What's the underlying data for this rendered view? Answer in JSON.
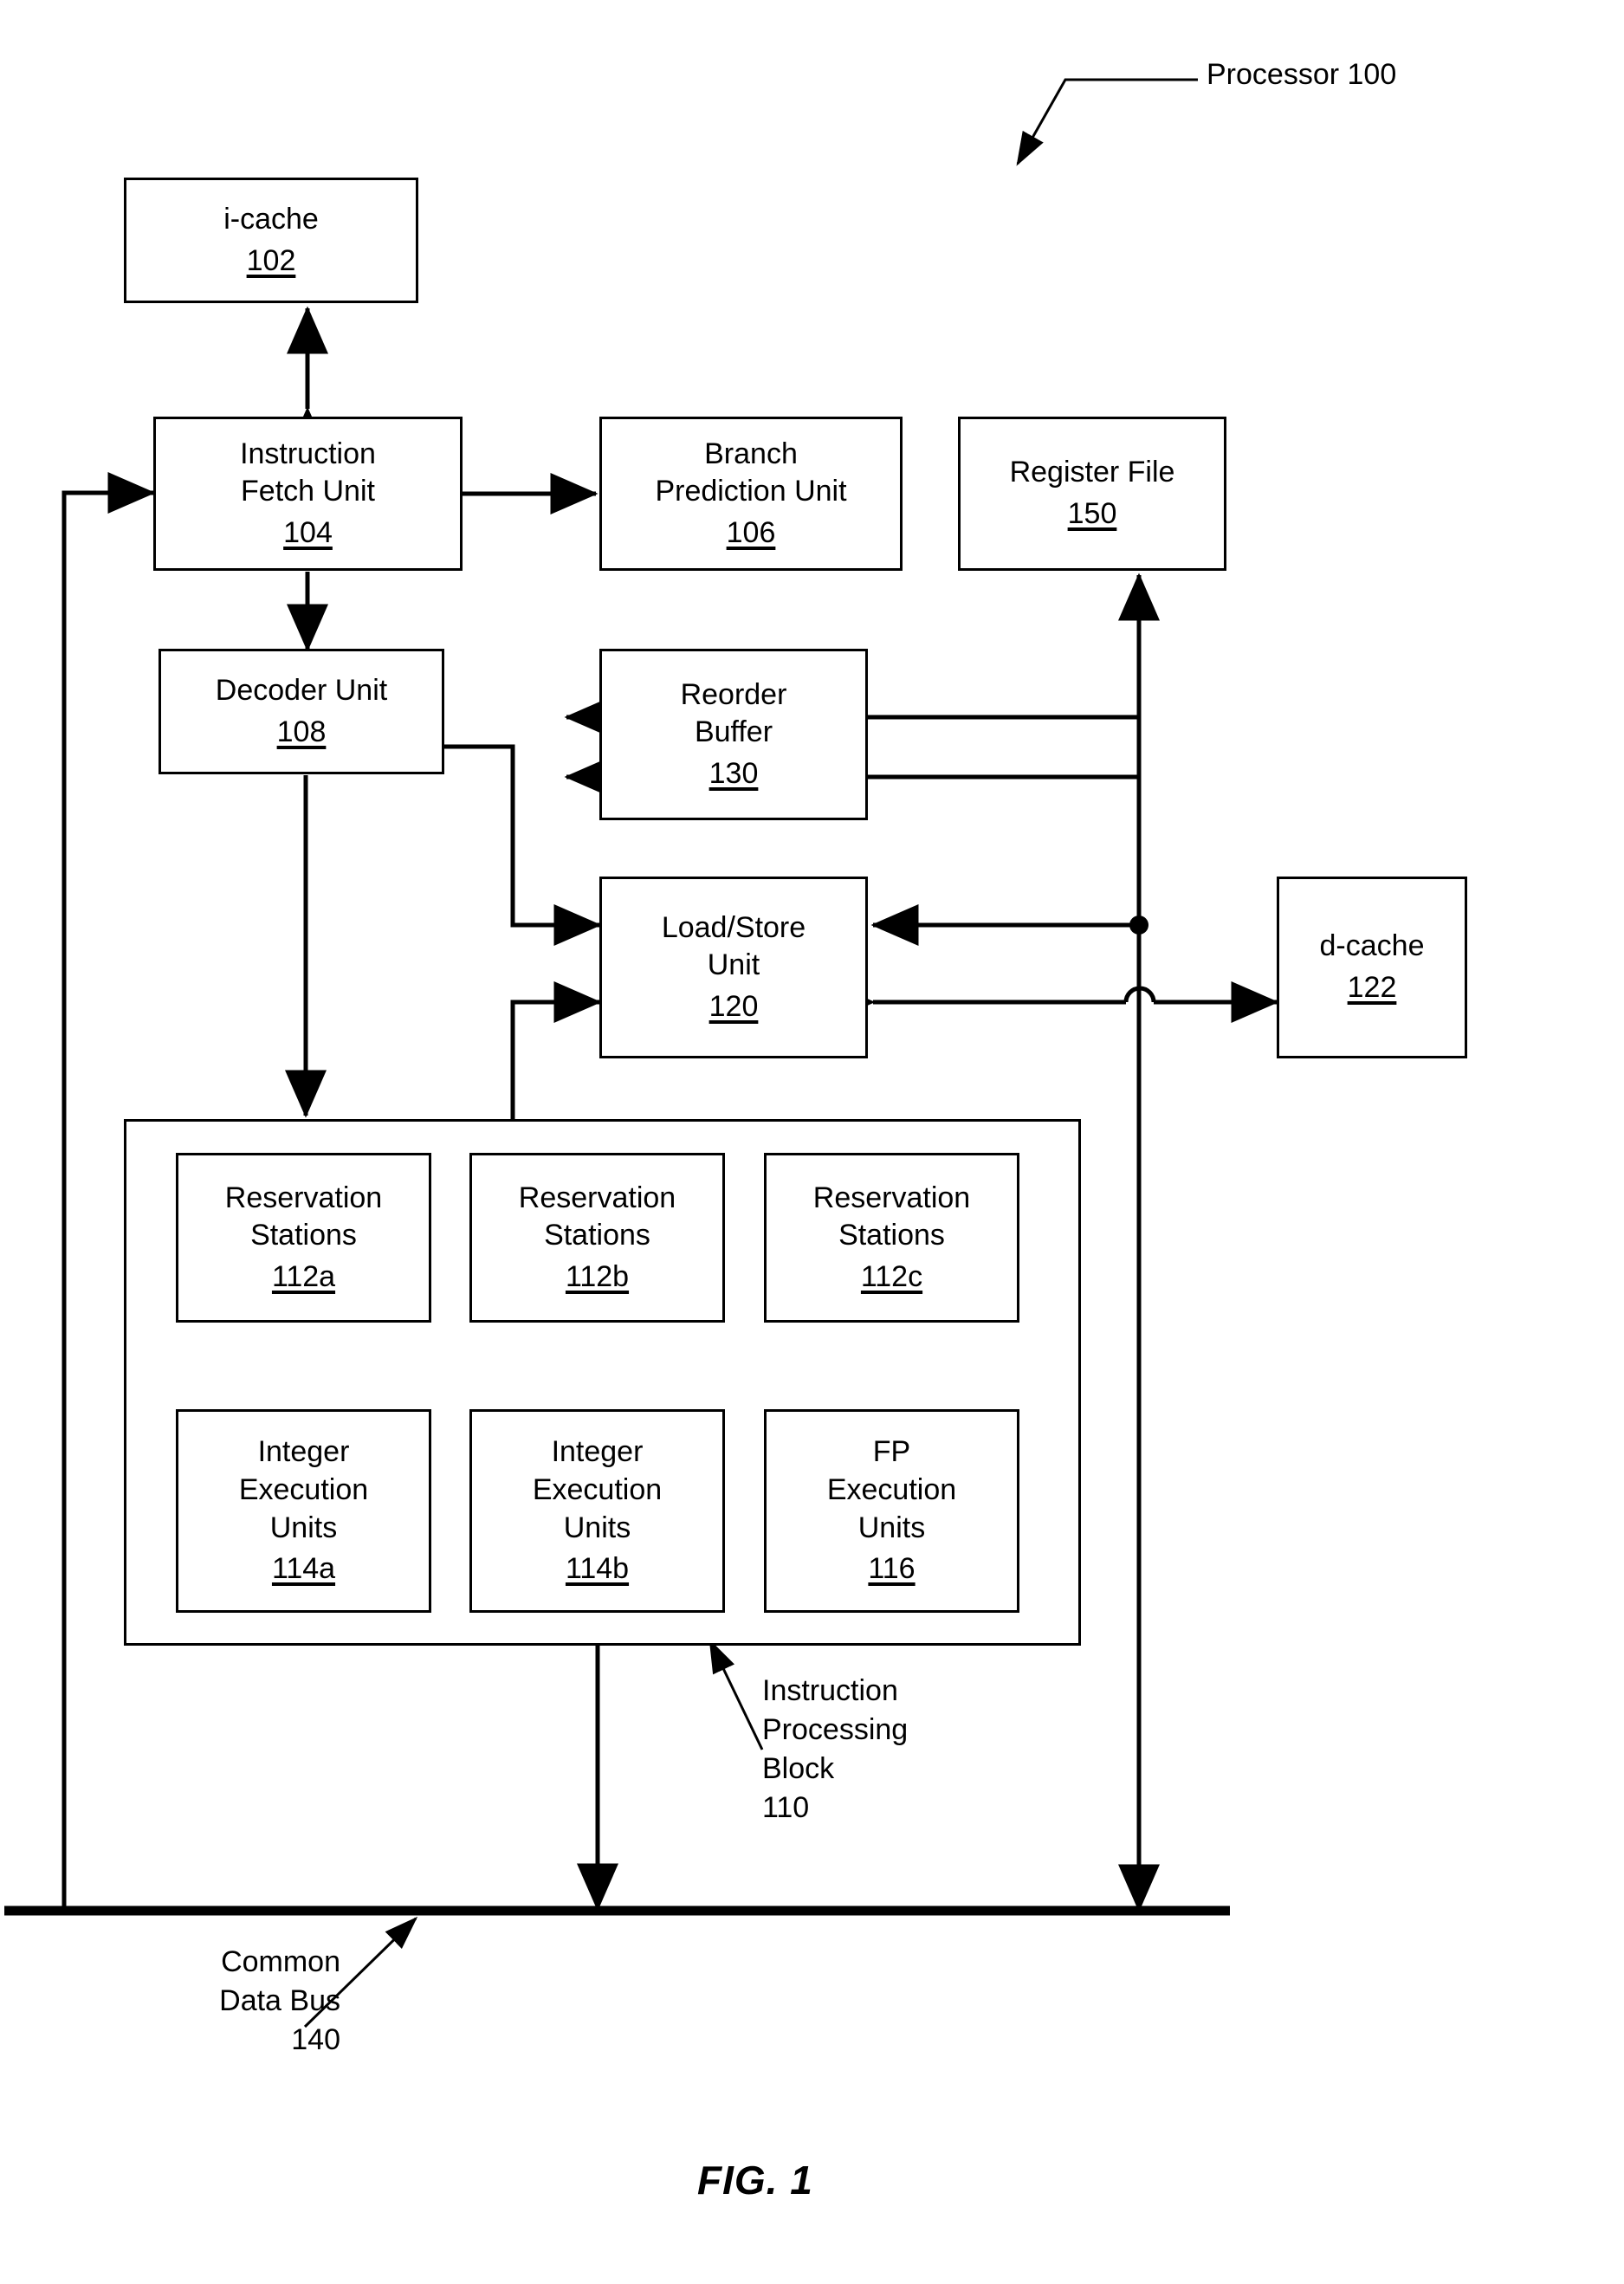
{
  "figure": {
    "caption": "FIG. 1",
    "top_label": "Processor 100"
  },
  "blocks": [
    {
      "id": "i-cache",
      "title": "i-cache",
      "ref": "102"
    },
    {
      "id": "instruction-fetch",
      "title": "Instruction\nFetch Unit",
      "ref": "104"
    },
    {
      "id": "branch-prediction",
      "title": "Branch\nPrediction Unit",
      "ref": "106"
    },
    {
      "id": "register-file",
      "title": "Register File",
      "ref": "150"
    },
    {
      "id": "decoder",
      "title": "Decoder Unit",
      "ref": "108"
    },
    {
      "id": "reorder-buffer",
      "title": "Reorder\nBuffer",
      "ref": "130"
    },
    {
      "id": "load-store",
      "title": "Load/Store\nUnit",
      "ref": "120"
    },
    {
      "id": "d-cache",
      "title": "d-cache",
      "ref": "122"
    },
    {
      "id": "reservation-a",
      "title": "Reservation\nStations",
      "ref": "112a"
    },
    {
      "id": "reservation-b",
      "title": "Reservation\nStations",
      "ref": "112b"
    },
    {
      "id": "reservation-c",
      "title": "Reservation\nStations",
      "ref": "112c"
    },
    {
      "id": "integer-exec-a",
      "title": "Integer\nExecution\nUnits",
      "ref": "114a"
    },
    {
      "id": "integer-exec-b",
      "title": "Integer\nExecution\nUnits",
      "ref": "114b"
    },
    {
      "id": "fp-exec",
      "title": "FP\nExecution\nUnits",
      "ref": "116"
    }
  ],
  "callouts": {
    "instruction_processing_block": "Instruction\nProcessing\nBlock\n110",
    "common_data_bus": "Common\nData Bus\n140"
  },
  "colors": {
    "stroke": "#000000",
    "background": "#ffffff"
  }
}
